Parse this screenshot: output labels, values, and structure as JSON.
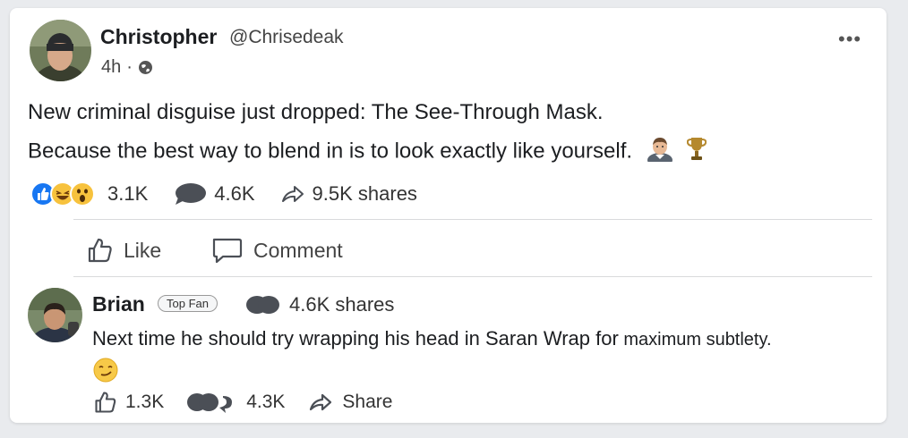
{
  "post": {
    "author_name": "Christopher",
    "author_handle": "@Chrisedeak",
    "time": "4h",
    "separator": "·",
    "text_line1": "New criminal disguise just dropped: The See-Through Mask.",
    "text_line2": "Because the best way to blend in is to look exactly like yourself.",
    "inline_icons": [
      "man-face-icon",
      "trophy-icon"
    ],
    "reactions": [
      "like-reaction-icon",
      "laugh-reaction-icon",
      "wow-reaction-icon"
    ],
    "reactions_count": "3.1K",
    "comments_count": "4.6K",
    "shares_text": "9.5K shares"
  },
  "actions": {
    "like_label": "Like",
    "comment_label": "Comment"
  },
  "comment": {
    "author_name": "Brian",
    "badge": "Top Fan",
    "shares_text": "4.6K shares",
    "text_main": "Next time he should try wrapping his head in Saran Wrap for",
    "text_tail": " maximum subtlety.",
    "emoji": "smirk-face-icon",
    "likes_count": "1.3K",
    "comments_count": "4.3K",
    "share_label": "Share"
  },
  "colors": {
    "background": "#e9ebee",
    "card": "#ffffff",
    "like_blue": "#1877f2",
    "reaction_yellow": "#f7c23d",
    "icon_gray": "#4b4f56"
  }
}
